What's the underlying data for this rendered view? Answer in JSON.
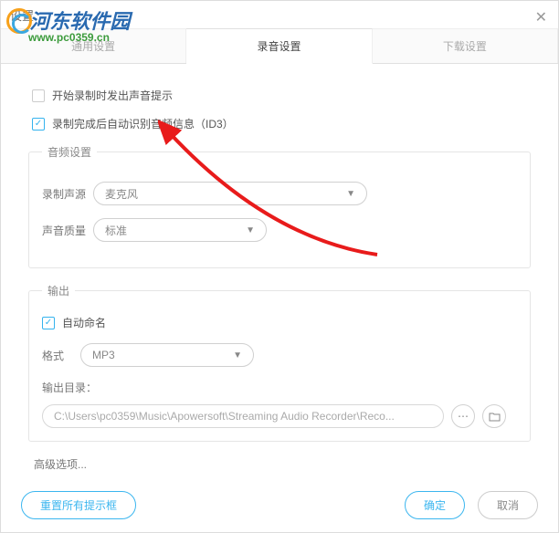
{
  "title": "设置",
  "watermark": {
    "text": "河东软件园",
    "url": "www.pc0359.cn"
  },
  "tabs": {
    "general": "通用设置",
    "record": "录音设置",
    "download": "下载设置"
  },
  "checks": {
    "beepStart": "开始录制时发出声音提示",
    "autoId3": "录制完成后自动识别音频信息（ID3）"
  },
  "audio": {
    "legend": "音频设置",
    "sourceLabel": "录制声源",
    "sourceValue": "麦克风",
    "qualityLabel": "声音质量",
    "qualityValue": "标准"
  },
  "output": {
    "legend": "输出",
    "autoName": "自动命名",
    "formatLabel": "格式",
    "formatValue": "MP3",
    "dirLabel": "输出目录：",
    "dirValue": "C:\\Users\\pc0359\\Music\\Apowersoft\\Streaming Audio Recorder\\Reco..."
  },
  "advanced": "高级选项...",
  "buttons": {
    "reset": "重置所有提示框",
    "ok": "确定",
    "cancel": "取消"
  }
}
